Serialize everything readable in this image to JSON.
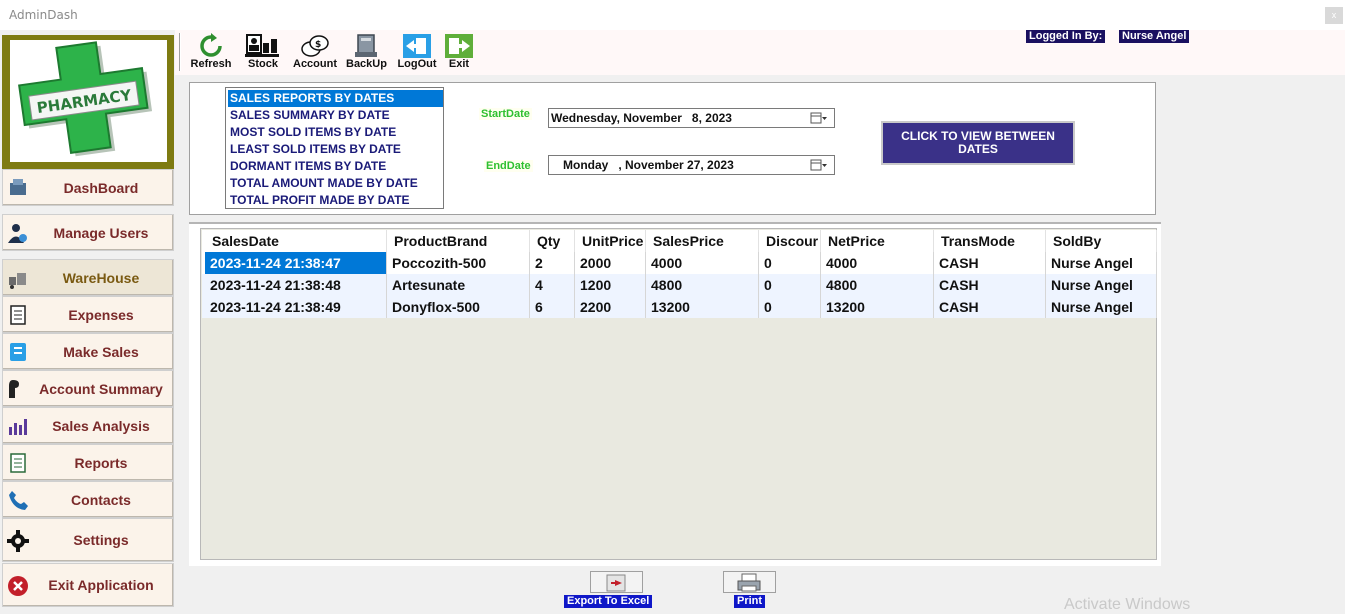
{
  "window": {
    "title": "AdminDash",
    "close_glyph": "x"
  },
  "toolbar": {
    "items": [
      {
        "label": "Refresh",
        "icon": "refresh-icon"
      },
      {
        "label": "Stock",
        "icon": "stock-icon"
      },
      {
        "label": "Account",
        "icon": "account-icon"
      },
      {
        "label": "BackUp",
        "icon": "backup-icon"
      },
      {
        "label": "LogOut",
        "icon": "logout-icon"
      },
      {
        "label": "Exit",
        "icon": "exit-icon"
      }
    ],
    "logged_in_label": "Logged In By:",
    "logged_in_user": "Nurse Angel"
  },
  "logo": {
    "text": "PHARMACY",
    "accent": "#2db34a"
  },
  "sidebar": {
    "items": [
      {
        "label": "DashBoard",
        "icon": "dashboard-icon"
      },
      {
        "label": "Manage Users",
        "icon": "users-icon"
      },
      {
        "label": "WareHouse",
        "icon": "warehouse-icon"
      },
      {
        "label": "Expenses",
        "icon": "expenses-icon"
      },
      {
        "label": "Make Sales",
        "icon": "sales-icon"
      },
      {
        "label": "Account Summary",
        "icon": "account-summary-icon"
      },
      {
        "label": "Sales Analysis",
        "icon": "chart-icon"
      },
      {
        "label": "Reports",
        "icon": "reports-icon"
      },
      {
        "label": "Contacts",
        "icon": "phone-icon"
      },
      {
        "label": "Settings",
        "icon": "gear-icon"
      },
      {
        "label": "Exit Application",
        "icon": "exit-circle-icon"
      }
    ]
  },
  "reports": {
    "selected": "SALES REPORTS BY DATES",
    "items": [
      "SALES REPORTS BY DATES",
      "SALES SUMMARY BY DATE",
      "MOST SOLD ITEMS BY DATE",
      "LEAST SOLD ITEMS BY DATE",
      "DORMANT ITEMS BY DATE",
      "TOTAL AMOUNT MADE BY DATE",
      "TOTAL PROFIT MADE BY DATE"
    ]
  },
  "filters": {
    "start_label": "StartDate",
    "start_value": "Wednesday, November   8, 2023",
    "end_label": "EndDate",
    "end_value": "Monday   , November 27, 2023",
    "view_button": "CLICK TO VIEW BETWEEN DATES"
  },
  "grid": {
    "columns": [
      "SalesDate",
      "ProductBrand",
      "Qty",
      "UnitPrice",
      "SalesPrice",
      "Discour",
      "NetPrice",
      "TransMode",
      "SoldBy"
    ],
    "rows": [
      [
        "2023-11-24 21:38:47",
        "Poccozith-500",
        "2",
        "2000",
        "4000",
        "0",
        "4000",
        "CASH",
        "Nurse Angel"
      ],
      [
        "2023-11-24 21:38:48",
        "Artesunate",
        "4",
        "1200",
        "4800",
        "0",
        "4800",
        "CASH",
        "Nurse Angel"
      ],
      [
        "2023-11-24 21:38:49",
        "Donyflox-500",
        "6",
        "2200",
        "13200",
        "0",
        "13200",
        "CASH",
        "Nurse Angel"
      ]
    ]
  },
  "actions": {
    "export_label": "Export To Excel",
    "print_label": "Print"
  },
  "watermark": "Activate Windows"
}
